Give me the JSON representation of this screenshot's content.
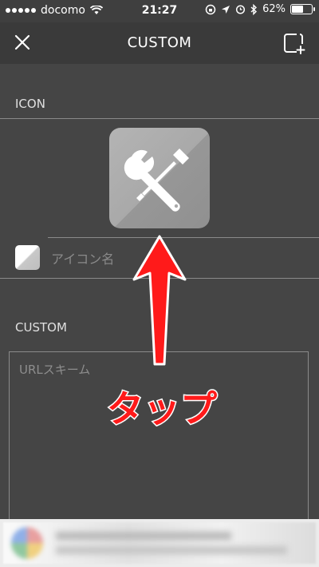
{
  "status_bar": {
    "carrier": "docomo",
    "time": "21:27",
    "battery_percent_label": "62%",
    "battery_level": 0.62
  },
  "nav": {
    "title": "CUSTOM",
    "close_icon": "close-icon",
    "add_icon": "add-square-icon"
  },
  "icon_section": {
    "label": "ICON",
    "icon_name": "tools-icon",
    "name_placeholder": "アイコン名"
  },
  "custom_section": {
    "label": "CUSTOM",
    "url_placeholder": "URLスキーム"
  },
  "annotation": {
    "tap_text": "タップ",
    "color": "#ff1a1a"
  },
  "colors": {
    "background": "#454545",
    "nav_background": "#3a3a3a"
  }
}
